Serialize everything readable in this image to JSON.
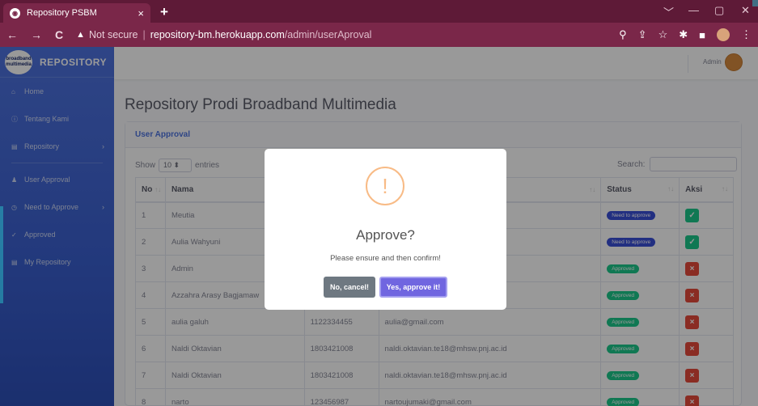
{
  "browser": {
    "tab_title": "Repository PSBM",
    "tab_close": "×",
    "new_tab": "+",
    "window_controls": [
      "﹀",
      "—",
      "▢",
      "✕"
    ],
    "nav_back": "←",
    "nav_forward": "→",
    "nav_reload": "C",
    "not_secure": "Not secure",
    "url_host": "repository-bm.herokuapp.com",
    "url_path": "/admin/userAproval"
  },
  "sidebar": {
    "logo_text": "broadband multimedia",
    "brand": "REPOSITORY",
    "items": [
      {
        "label": "Home",
        "icon": "home-icon",
        "glyph": "⌂"
      },
      {
        "label": "Tentang Kami",
        "icon": "info-icon",
        "glyph": "ⓘ"
      },
      {
        "label": "Repository",
        "icon": "file-icon",
        "glyph": "▤",
        "caret": "›"
      },
      {
        "label": "User Approval",
        "icon": "user-check-icon",
        "glyph": "♟"
      },
      {
        "label": "Need to Approve",
        "icon": "clock-icon",
        "glyph": "◷",
        "caret": "›"
      },
      {
        "label": "Approved",
        "icon": "check-circle-icon",
        "glyph": "✓"
      },
      {
        "label": "My Repository",
        "icon": "folder-icon",
        "glyph": "▤"
      }
    ]
  },
  "topbar": {
    "user_name": "Admin"
  },
  "page": {
    "title": "Repository Prodi Broadband Multimedia"
  },
  "card": {
    "header": "User Approval",
    "show_label": "Show",
    "entries_value": "10",
    "entries_label": "entries",
    "search_label": "Search:"
  },
  "table": {
    "headers": {
      "no": "No",
      "nama": "Nama",
      "status": "Status",
      "aksi": "Aksi"
    },
    "rows": [
      {
        "no": "1",
        "nama": "Meutia",
        "nim": "",
        "email": "",
        "status": "Need to approve",
        "approved": false
      },
      {
        "no": "2",
        "nama": "Aulia Wahyuni",
        "nim": "",
        "email": "l",
        "status": "Need to approve",
        "approved": false
      },
      {
        "no": "3",
        "nama": "Admin",
        "nim": "",
        "email": "",
        "status": "Approved",
        "approved": true
      },
      {
        "no": "4",
        "nama": "Azzahra Arasy Bagjamaw",
        "nim": "",
        "email": "mhsw.pnj.ac.id",
        "status": "Approved",
        "approved": true
      },
      {
        "no": "5",
        "nama": "aulia galuh",
        "nim": "1122334455",
        "email": "aulia@gmail.com",
        "status": "Approved",
        "approved": true
      },
      {
        "no": "6",
        "nama": "Naldi Oktavian",
        "nim": "1803421008",
        "email": "naldi.oktavian.te18@mhsw.pnj.ac.id",
        "status": "Approved",
        "approved": true
      },
      {
        "no": "7",
        "nama": "Naldi Oktavian",
        "nim": "1803421008",
        "email": "naldi.oktavian.te18@mhsw.pnj.ac.id",
        "status": "Approved",
        "approved": true
      },
      {
        "no": "8",
        "nama": "narto",
        "nim": "123456987",
        "email": "nartoujumaki@gmail.com",
        "status": "Approved",
        "approved": true
      }
    ]
  },
  "modal": {
    "icon": "!",
    "title": "Approve?",
    "text": "Please ensure and then confirm!",
    "cancel_label": "No, cancel!",
    "confirm_label": "Yes, approve it!"
  },
  "colors": {
    "browser_frame": "#7a2749",
    "sidebar": "#4e73df",
    "accent": "#4e73df",
    "confirm_button": "#7066e0",
    "cancel_button": "#6e7881",
    "approved": "#1cc88a",
    "reject": "#e74a3b",
    "warning_icon": "#f8bb86"
  }
}
